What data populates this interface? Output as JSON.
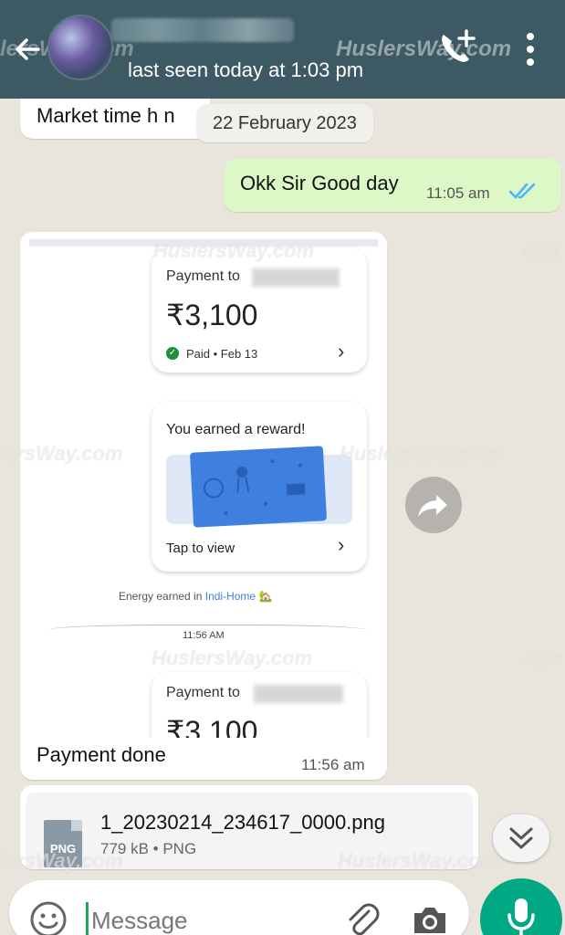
{
  "header": {
    "status": "last seen today at 1:03 pm",
    "watermark": "HuslersWay.com",
    "watermark_left": "lersWay.com"
  },
  "chat": {
    "partial_message": "Market time h n",
    "date_chip": "22 February 2023",
    "outgoing": {
      "text": "Okk Sir Good day",
      "time": "11:05 am"
    },
    "image_message": {
      "payment_label": "Payment to",
      "amount": "₹3,100",
      "paid_status": "Paid • Feb 13",
      "reward_title": "You earned a reward!",
      "reward_action": "Tap to view",
      "energy_prefix": "Energy earned in",
      "energy_place": "Indi-Home",
      "separator_time": "11:56 AM",
      "payment_label_2": "Payment to",
      "amount_2": "₹3,100",
      "caption": "Payment done",
      "time": "11:56 am"
    },
    "document": {
      "icon_label": "PNG",
      "filename": "1_20230214_234617_0000.png",
      "meta": "779 kB • PNG"
    }
  },
  "composer": {
    "placeholder": "Message"
  },
  "watermarks": {
    "w1": "HuslersWay.com",
    "w2": "Hus",
    "w3": "lersWay.com",
    "w4": "HuslersWay.com",
    "w5": "HuslersWay.com",
    "w6": "Hus",
    "w7": "lersWay.com",
    "w8": "HuslersWay.com"
  }
}
